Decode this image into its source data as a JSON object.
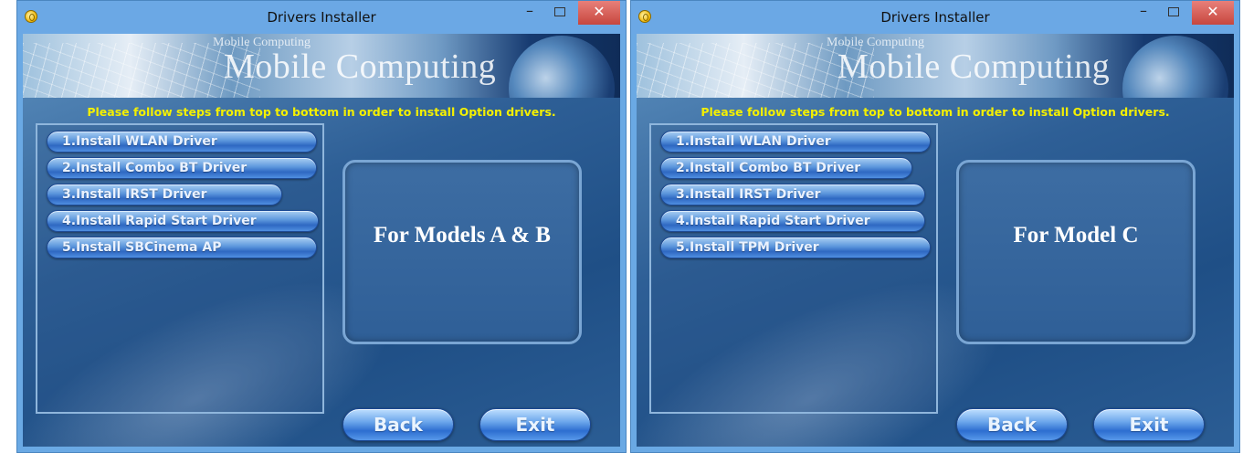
{
  "windows": [
    {
      "title": "Drivers Installer",
      "controls": {
        "minimize": "–",
        "close": "✕"
      },
      "banner_small": "Mobile Computing",
      "banner_title": "Mobile Computing",
      "instruction": "Please follow steps from top to bottom in order to install Option drivers.",
      "steps": [
        "1.Install WLAN Driver",
        "2.Install Combo BT Driver",
        "3.Install IRST Driver",
        "4.Install Rapid Start Driver",
        "5.Install SBCinema AP"
      ],
      "model_label": "For Models A & B",
      "back_label": "Back",
      "exit_label": "Exit"
    },
    {
      "title": "Drivers Installer",
      "controls": {
        "minimize": "–",
        "close": "✕"
      },
      "banner_small": "Mobile Computing",
      "banner_title": "Mobile Computing",
      "instruction": "Please follow steps from top to bottom in order to install Option drivers.",
      "steps": [
        "1.Install WLAN Driver",
        "2.Install Combo BT Driver",
        "3.Install IRST Driver",
        "4.Install Rapid Start Driver",
        "5.Install TPM Driver"
      ],
      "model_label": "For Model C",
      "back_label": "Back",
      "exit_label": "Exit"
    }
  ],
  "colors": {
    "instruction_text": "#f4f000",
    "titlebar": "#6ba8e5",
    "close_button": "#c7463e"
  }
}
